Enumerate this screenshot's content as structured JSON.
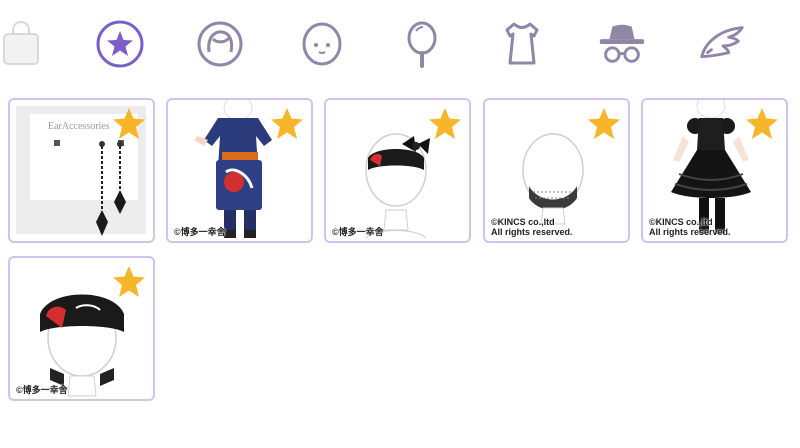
{
  "tabs": [
    {
      "id": "shop-bag",
      "icon": "shopping-bag-icon",
      "active": false,
      "faded": true
    },
    {
      "id": "favorites",
      "icon": "star-icon",
      "active": true
    },
    {
      "id": "hair",
      "icon": "hair-icon",
      "active": false
    },
    {
      "id": "face",
      "icon": "face-icon",
      "active": false
    },
    {
      "id": "mirror",
      "icon": "mirror-icon",
      "active": false
    },
    {
      "id": "clothes",
      "icon": "dress-icon",
      "active": false
    },
    {
      "id": "accessories",
      "icon": "hat-glasses-icon",
      "active": false
    },
    {
      "id": "wings",
      "icon": "wing-icon",
      "active": false
    }
  ],
  "colors": {
    "accent": "#7b5fc9",
    "tab_icon": "#8f86a8",
    "card_border": "#cfc4ec",
    "star": "#f7b62a"
  },
  "items": [
    {
      "name": "ear-accessories-item",
      "label": "EarAccessories",
      "copyright": "",
      "favorited": true
    },
    {
      "name": "happi-outfit-item",
      "label": "",
      "copyright": "©博多一幸舎",
      "favorited": true
    },
    {
      "name": "bandana-bow-item",
      "label": "",
      "copyright": "©博多一幸舎",
      "favorited": true
    },
    {
      "name": "lace-mask-item",
      "label": "",
      "copyright": "©KINCS co.,ltd\n  All rights reserved.",
      "favorited": true
    },
    {
      "name": "black-lolita-dress-item",
      "label": "",
      "copyright": "©KINCS co.,ltd\n  All rights reserved.",
      "favorited": true
    },
    {
      "name": "headband-item",
      "label": "",
      "copyright": "©博多一幸舎",
      "favorited": true
    }
  ]
}
